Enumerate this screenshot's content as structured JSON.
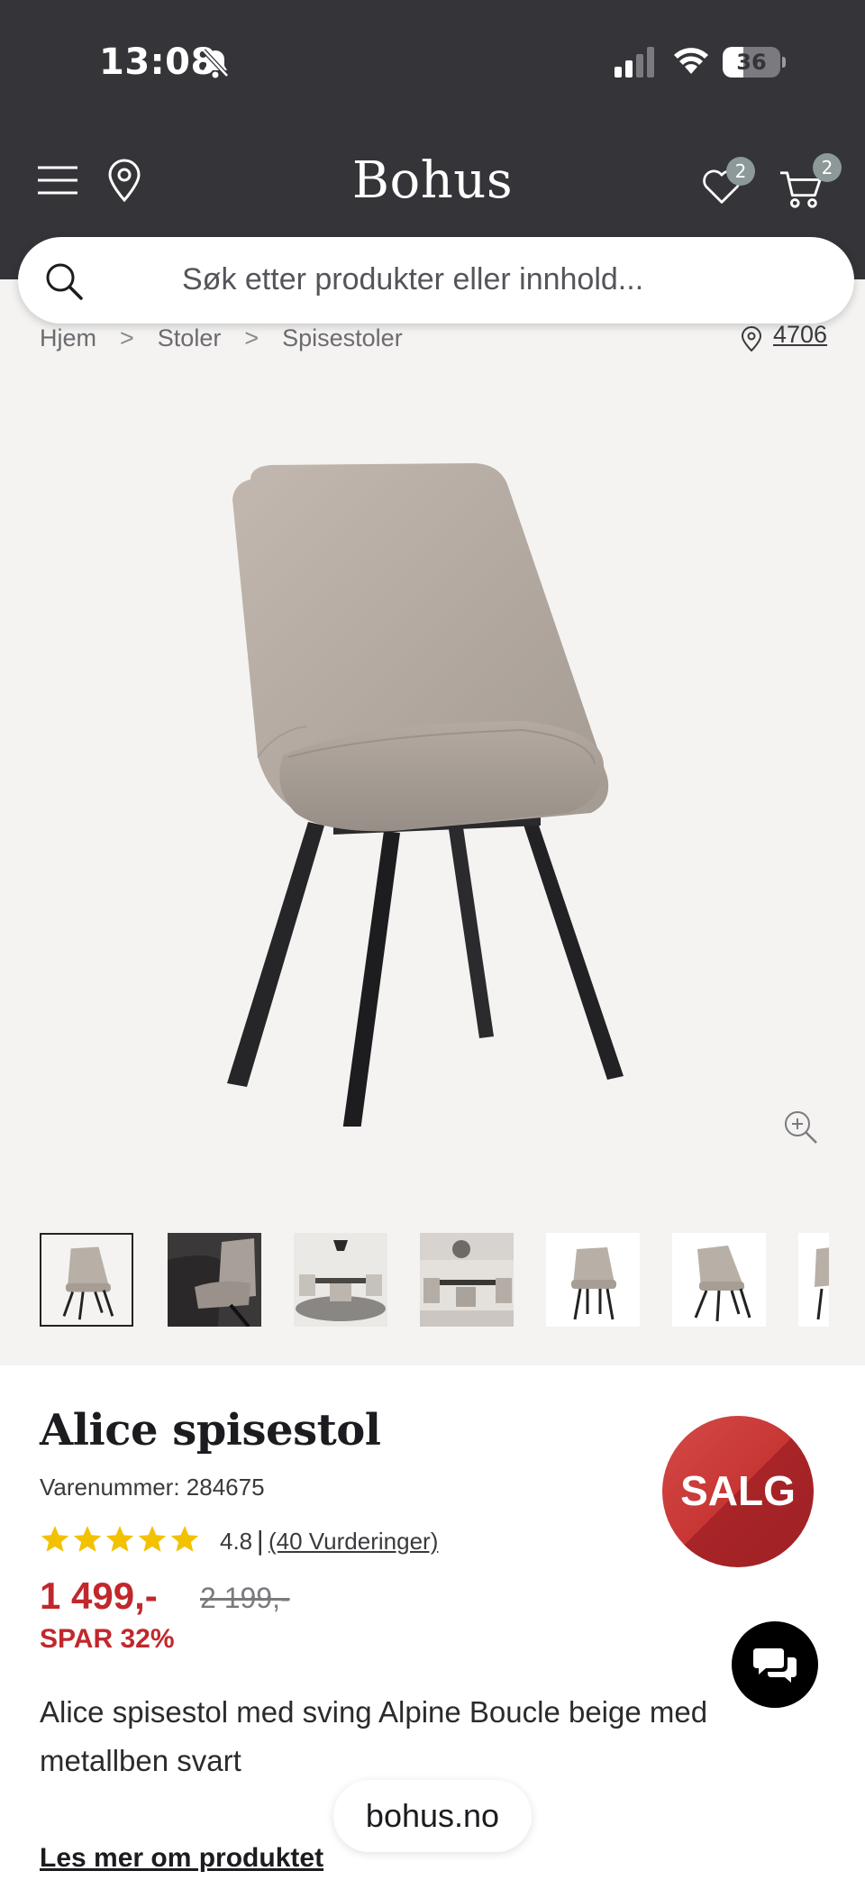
{
  "status_bar": {
    "time": "13:08",
    "battery_level": "36",
    "icons": [
      "bell-off-icon",
      "signal-icon",
      "wifi-icon",
      "battery-icon"
    ]
  },
  "header": {
    "logo": "Bohus",
    "wishlist_count": "2",
    "cart_count": "2",
    "colors": {
      "background": "#353439",
      "badge": "#8d9998"
    }
  },
  "search": {
    "placeholder": "Søk etter produkter eller innhold..."
  },
  "breadcrumb": {
    "items": [
      "Hjem",
      "Stoler",
      "Spisestoler"
    ],
    "separator": ">",
    "store_number": "4706"
  },
  "gallery": {
    "thumbnail_count": 7,
    "active_thumbnail": 0
  },
  "product": {
    "title": "Alice spisestol",
    "sku": "Varenummer: 284675",
    "rating_value": "4.8",
    "rating_separator": "|",
    "rating_count": "(40 Vurderinger)",
    "stars": 5,
    "price_now": "1 499,-",
    "price_old": "2 199,-",
    "save_text": "SPAR 32%",
    "sale_badge": "SALG",
    "description": "Alice spisestol med sving Alpine Boucle beige med metallben svart",
    "read_more": "Les mer om produktet",
    "colors": {
      "price": "#c0282c",
      "star": "#f2c200",
      "sale": "#c73634"
    }
  },
  "browser": {
    "url": "bohus.no"
  }
}
